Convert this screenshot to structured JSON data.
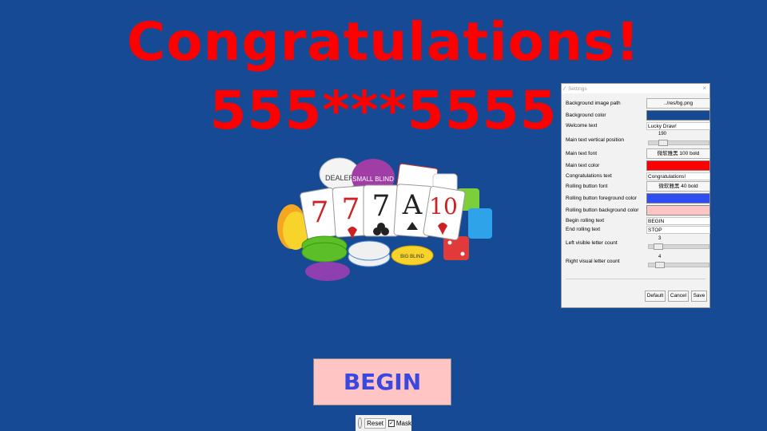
{
  "headline": "Congratulations!",
  "number": "555***5555",
  "begin_button": "BEGIN",
  "bottom_bar": {
    "reset_label": "Reset",
    "mask_label": "Mask",
    "mask_checked": "✓"
  },
  "art": {
    "chips": [
      "DEALER",
      "SMALL BLIND",
      "BIG BLIND"
    ],
    "cards": [
      "7",
      "7",
      "7",
      "A",
      "10"
    ]
  },
  "colors": {
    "background": "#174a94",
    "headline": "#ff0000",
    "button_fg": "#3a48e0",
    "button_bg": "#ffc4c4"
  },
  "settings": {
    "title": "Settings",
    "close": "×",
    "rows": {
      "bg_image": {
        "label": "Background image path",
        "value": "../res/bg.png"
      },
      "bg_color": {
        "label": "Background color",
        "color": "#174a94"
      },
      "welcome": {
        "label": "Welcome text",
        "value": "Lucky Draw!"
      },
      "main_pos": {
        "label": "Main text vertical position",
        "value": "190",
        "fraction": 0.19
      },
      "main_font": {
        "label": "Main text font",
        "value": "微软雅黑 100 bold"
      },
      "main_color": {
        "label": "Main text color",
        "color": "#ff0000"
      },
      "congrats_text": {
        "label": "Congratulations text",
        "value": "Congratulations!"
      },
      "roll_font": {
        "label": "Rolling button font",
        "value": "微软雅黑 40 bold"
      },
      "roll_fg": {
        "label": "Rolling button foreground color",
        "color": "#2f4ef2"
      },
      "roll_bg": {
        "label": "Rolling button background color",
        "color": "#ffc4c4"
      },
      "begin_text": {
        "label": "Begin rolling text",
        "value": "BEGIN"
      },
      "end_text": {
        "label": "End rolling text",
        "value": "STOP"
      },
      "left_count": {
        "label": "Left visible letter count",
        "value": "3",
        "fraction": 0.1
      },
      "right_count": {
        "label": "Right visual letter count",
        "value": "4",
        "fraction": 0.13
      }
    },
    "buttons": {
      "default": "Default",
      "cancel": "Cancel",
      "save": "Save"
    }
  }
}
